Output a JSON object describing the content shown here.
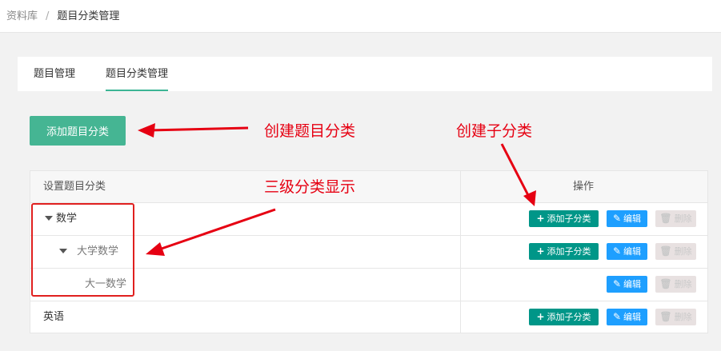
{
  "breadcrumb": {
    "root": "资料库",
    "separator": "/",
    "current": "题目分类管理"
  },
  "tabs": [
    {
      "label": "题目管理",
      "active": false
    },
    {
      "label": "题目分类管理",
      "active": true
    }
  ],
  "add_button_label": "添加题目分类",
  "table": {
    "headers": [
      "设置题目分类",
      "操作"
    ],
    "rows": [
      {
        "name": "数学",
        "level": 1,
        "expanded": true,
        "actions": [
          "添加子分类",
          "编辑",
          "删除"
        ]
      },
      {
        "name": "大学数学",
        "level": 2,
        "expanded": true,
        "actions": [
          "添加子分类",
          "编辑",
          "删除"
        ]
      },
      {
        "name": "大一数学",
        "level": 3,
        "expanded": false,
        "actions": [
          "编辑",
          "删除"
        ]
      },
      {
        "name": "英语",
        "level": 1,
        "expanded": false,
        "actions": [
          "添加子分类",
          "编辑",
          "删除"
        ]
      }
    ]
  },
  "annotations": {
    "create_category": "创建题目分类",
    "create_subcategory": "创建子分类",
    "three_level_display": "三级分类显示"
  },
  "colors": {
    "primary": "#45b593",
    "add_sub": "#009688",
    "edit": "#1e9fff",
    "delete_disabled": "#e8e1e1",
    "annotation_red": "#e60012"
  }
}
